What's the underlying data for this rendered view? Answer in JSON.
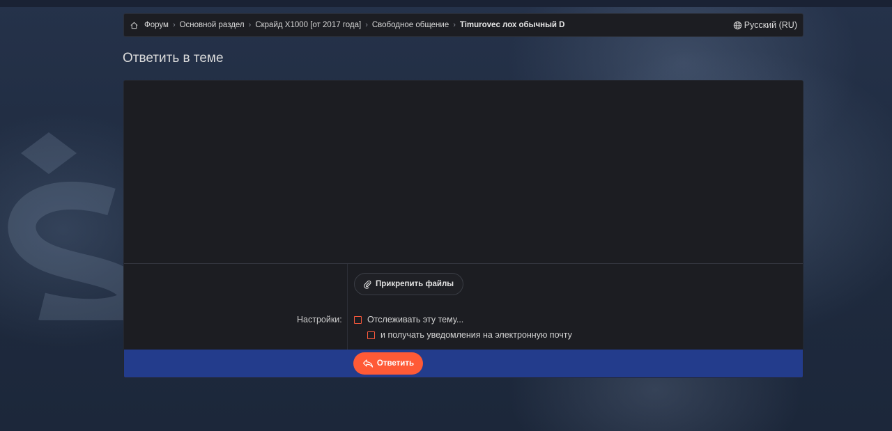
{
  "breadcrumb": {
    "items": [
      {
        "label": "Форум"
      },
      {
        "label": "Основной раздел"
      },
      {
        "label": "Скрайд X1000 [от 2017 года]"
      },
      {
        "label": "Свободное общение"
      },
      {
        "label": "Timurovec лох обычный D"
      }
    ],
    "home_icon": "home-icon"
  },
  "language": {
    "label": "Русский (RU)",
    "icon": "globe-icon"
  },
  "page": {
    "title": "Ответить в теме"
  },
  "form": {
    "attach_label": "Прикрепить файлы",
    "attach_icon": "paperclip-icon",
    "settings_label": "Настройки:",
    "options": [
      {
        "label": "Отслеживать эту тему...",
        "checked": false
      },
      {
        "label": "и получать уведомления на электронную почту",
        "checked": false
      }
    ],
    "submit_label": "Ответить",
    "submit_icon": "reply-icon"
  },
  "colors": {
    "accent": "#ff5a36",
    "submit_bar": "#233c8c",
    "panel": "#1c1d22"
  }
}
